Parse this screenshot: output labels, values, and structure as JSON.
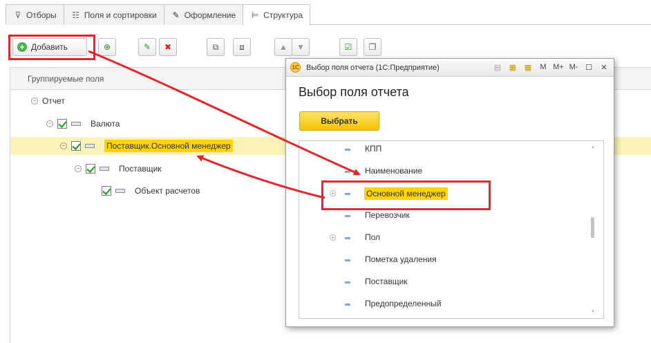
{
  "tabs": [
    {
      "label": "Отборы",
      "icon": "filter-icon"
    },
    {
      "label": "Поля и сортировки",
      "icon": "fields-icon"
    },
    {
      "label": "Оформление",
      "icon": "brush-icon"
    },
    {
      "label": "Структура",
      "icon": "structure-icon",
      "active": true
    }
  ],
  "toolbar": {
    "add_label": "Добавить"
  },
  "tree": {
    "header": "Группируемые поля",
    "rows": [
      {
        "label": "Отчет"
      },
      {
        "label": "Валюта"
      },
      {
        "label": "Поставщик.Основной менеджер",
        "selected": true
      },
      {
        "label": "Поставщик"
      },
      {
        "label": "Объект расчетов"
      }
    ]
  },
  "dialog": {
    "window_title": "Выбор поля отчета  (1С:Предприятие)",
    "tools": [
      "M",
      "M+",
      "M-"
    ],
    "heading": "Выбор поля отчета",
    "choose_label": "Выбрать",
    "items": [
      {
        "label": "КПП",
        "expandable": false
      },
      {
        "label": "Наименование",
        "expandable": false
      },
      {
        "label": "Основной менеджер",
        "expandable": true,
        "highlighted": true
      },
      {
        "label": "Перевозчик",
        "expandable": false
      },
      {
        "label": "Пол",
        "expandable": true
      },
      {
        "label": "Пометка удаления",
        "expandable": false
      },
      {
        "label": "Поставщик",
        "expandable": false
      },
      {
        "label": "Предопределенный",
        "expandable": false
      }
    ]
  },
  "colors": {
    "annotation_red": "#e8232a",
    "highlight_yellow": "#ffd400",
    "selected_row": "#fbf3b8",
    "accent_button": "#f3c400"
  }
}
